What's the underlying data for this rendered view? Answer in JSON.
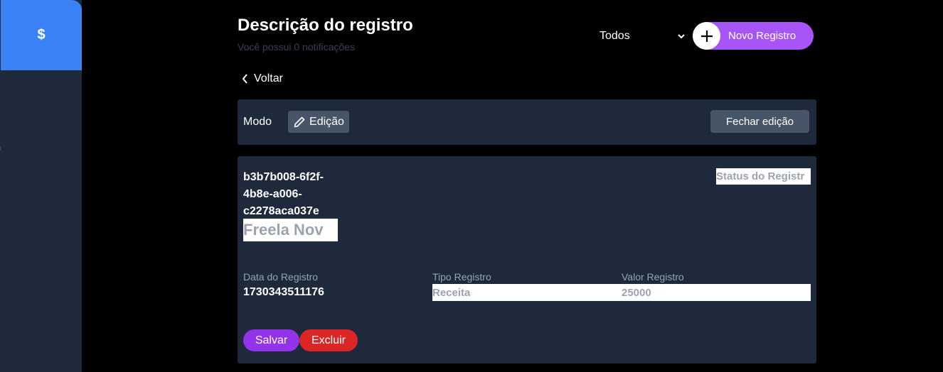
{
  "sidebar": {
    "logo_symbol": "$",
    "logo_color": "#3b82f6",
    "background": "#1e293b"
  },
  "header": {
    "title": "Descrição do registro",
    "subtitle": "Você possui 0 notificações",
    "filter": {
      "selected": "Todos"
    },
    "new_button": {
      "label": "Novo Registro",
      "icon": "plus-icon",
      "color": "#a855f7"
    }
  },
  "nav": {
    "back_label": "Voltar",
    "icon": "chevron-left-icon"
  },
  "mode_bar": {
    "label": "Modo",
    "mode_chip": {
      "label": "Edição",
      "icon": "pencil-icon"
    },
    "close_button": "Fechar edição"
  },
  "record": {
    "id_lines": [
      "b3b7b008-6f2f-",
      "4b8e-a006-",
      "c2278aca037e"
    ],
    "name": "Freela Nov",
    "status_label": "Status do Registr",
    "fields": {
      "date": {
        "label": "Data do Registro",
        "value": "1730343511176"
      },
      "type": {
        "label": "Tipo Registro",
        "value": "Receita"
      },
      "amount": {
        "label": "Valor Registro",
        "value": "25000"
      }
    },
    "save_button": "Salvar",
    "delete_button": "Excluir"
  },
  "colors": {
    "save": "#9333ea",
    "delete": "#dc2626",
    "card": "#1e293b",
    "chip": "#475569"
  }
}
